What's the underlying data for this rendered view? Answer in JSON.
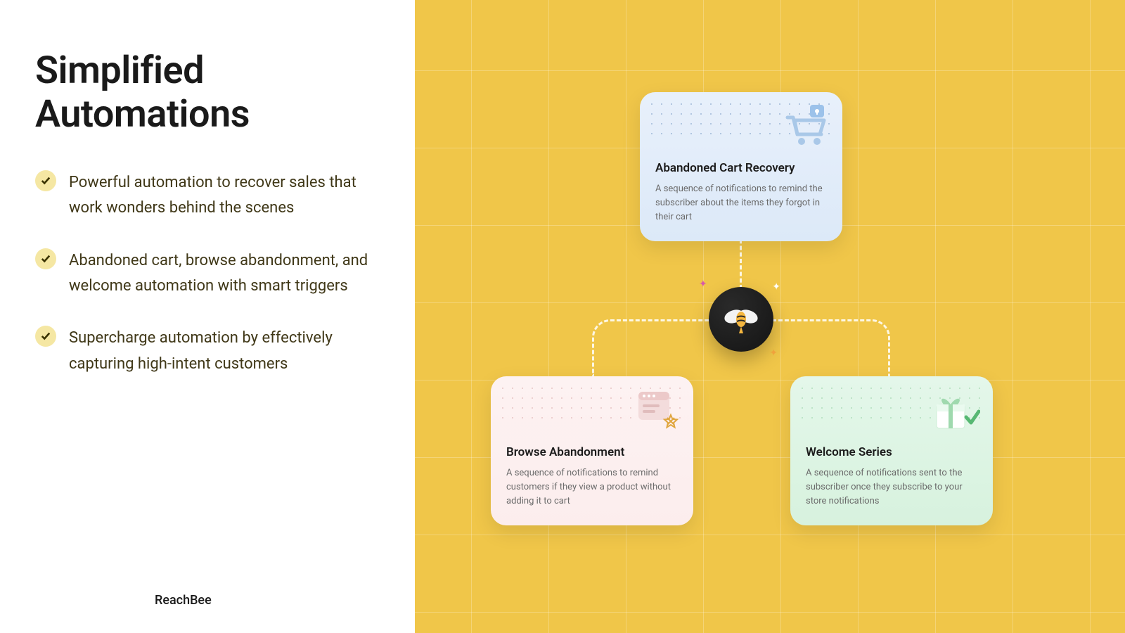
{
  "left": {
    "title": "Simplified Automations",
    "bullets": [
      "Powerful automation to recover sales that work wonders behind the scenes",
      "Abandoned cart, browse abandonment, and welcome automation with smart triggers",
      "Supercharge automation by effectively capturing high-intent customers"
    ],
    "brand": "ReachBee"
  },
  "cards": {
    "blue": {
      "title": "Abandoned Cart Recovery",
      "desc": "A sequence of notifications to remind the subscriber about the items they forgot in their cart"
    },
    "pink": {
      "title": "Browse Abandonment",
      "desc": "A sequence of notifications to remind customers if they view a product without adding it to cart"
    },
    "green": {
      "title": "Welcome Series",
      "desc": "A sequence of notifications sent to the subscriber once they subscribe to your store notifications"
    }
  },
  "colors": {
    "accent": "#f0c649",
    "check_bg": "#f5e7a3"
  }
}
